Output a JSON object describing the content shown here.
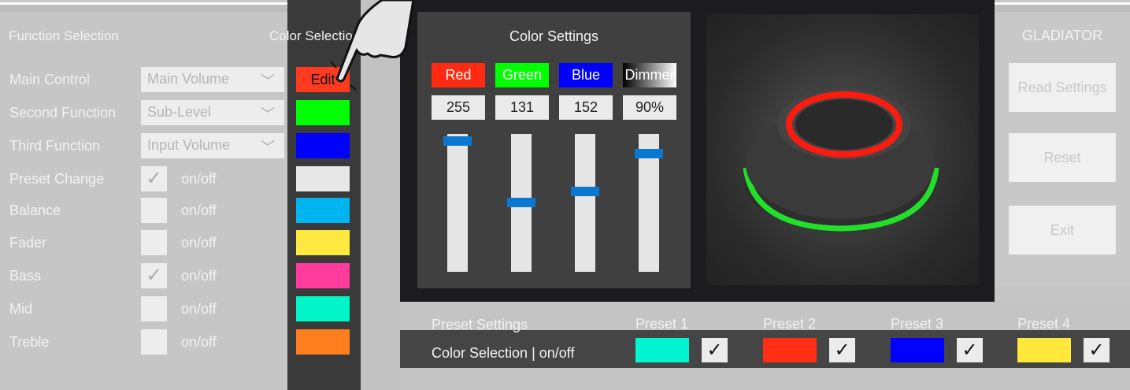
{
  "function_selection": {
    "title": "Function Selection",
    "rows": [
      {
        "label": "Main Control",
        "type": "dropdown",
        "value": "Main Volume"
      },
      {
        "label": "Second Function",
        "type": "dropdown",
        "value": "Sub-Level"
      },
      {
        "label": "Third Function",
        "type": "dropdown",
        "value": "Input Volume"
      },
      {
        "label": "Preset Change",
        "type": "checkbox",
        "checked": true,
        "suffix": "on/off"
      },
      {
        "label": "Balance",
        "type": "checkbox",
        "checked": false,
        "suffix": "on/off"
      },
      {
        "label": "Fader",
        "type": "checkbox",
        "checked": false,
        "suffix": "on/off"
      },
      {
        "label": "Bass",
        "type": "checkbox",
        "checked": true,
        "suffix": "on/off"
      },
      {
        "label": "Mid",
        "type": "checkbox",
        "checked": false,
        "suffix": "on/off"
      },
      {
        "label": "Treble",
        "type": "checkbox",
        "checked": false,
        "suffix": "on/off"
      }
    ]
  },
  "color_selection": {
    "title": "Color Selection",
    "edit_label": "Edit",
    "swatches": [
      "#ff3b1f",
      "#00ff00",
      "#0000ff",
      "#e8e8e8",
      "#00b4f0",
      "#ffe840",
      "#ff3c9c",
      "#00f5c8",
      "#ff7f20"
    ]
  },
  "color_settings": {
    "title": "Color Settings",
    "channels": [
      {
        "label": "Red",
        "value": "255",
        "fraction": 1.0,
        "color": "#ff2a12"
      },
      {
        "label": "Green",
        "value": "131",
        "fraction": 0.51,
        "color": "#00ff00"
      },
      {
        "label": "Blue",
        "value": "152",
        "fraction": 0.6,
        "color": "#0000ff"
      },
      {
        "label": "Dimmer",
        "value": "90%",
        "fraction": 0.9,
        "color": "#000000"
      }
    ]
  },
  "device": {
    "name": "GLADIATOR",
    "buttons": [
      "Read Settings",
      "Reset",
      "Exit"
    ]
  },
  "presets": {
    "title": "Preset Settings",
    "row_label": "Color Selection | on/off",
    "items": [
      {
        "label": "Preset 1",
        "color": "#00f5d0",
        "checked": true
      },
      {
        "label": "Preset 2",
        "color": "#ff2e14",
        "checked": true
      },
      {
        "label": "Preset 3",
        "color": "#0000ff",
        "checked": true
      },
      {
        "label": "Preset 4",
        "color": "#ffe83a",
        "checked": true
      }
    ]
  }
}
